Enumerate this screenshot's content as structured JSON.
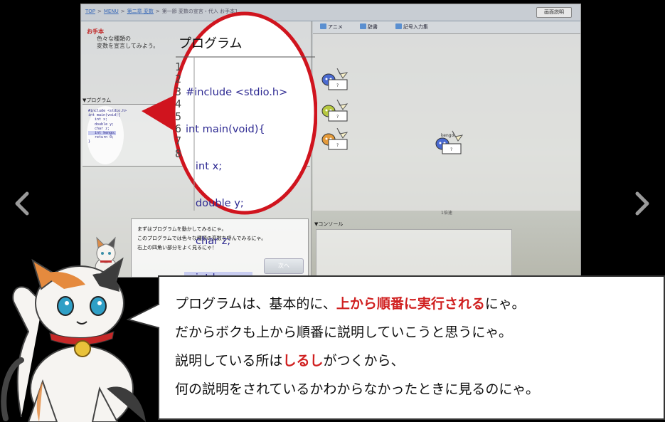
{
  "nav": {
    "prev_icon": "chevron-left-icon",
    "next_icon": "chevron-right-icon"
  },
  "app": {
    "breadcrumb": [
      "TOP",
      "MENU",
      "第二章 変数",
      "第一節 変数の宣言・代入 お手本1"
    ],
    "help_button": "画面説明",
    "otehon_title": "お手本",
    "otehon_body_1": "色々な種類の",
    "otehon_body_2": "変数を宣言してみよう。",
    "program_label": "▼プログラム",
    "tabs": [
      {
        "label": "アニメ",
        "icon": "animation-icon"
      },
      {
        "label": "辞書",
        "icon": "book-icon"
      },
      {
        "label": "記号入力集",
        "icon": "keyboard-icon"
      }
    ],
    "speed_label": "1倍速",
    "console_label": "▼コンソール",
    "variable_name": "kengo",
    "variable_value": "?",
    "dialog_lines": [
      "まずはプログラムを動かしてみるにゃ。",
      "このプログラムでは色々な種類の変数を呼んでみるにゃ。",
      "右上の四角い部分をよく見るにゃ！"
    ],
    "next_button": "次へ"
  },
  "magnifier": {
    "title": "プログラム",
    "line_numbers": [
      "1",
      "2",
      "3",
      "4",
      "5",
      "6",
      "7",
      "8"
    ],
    "code_lines": [
      "#include <stdio.h>",
      "int main(void){",
      "   int x;",
      "   double y;",
      "   char z;",
      "   int kengo;",
      "   return 0;",
      "}"
    ],
    "highlighted_line": 6
  },
  "bubble": {
    "line1_a": "プログラムは、基本的に、",
    "line1_red": "上から順番に実行される",
    "line1_b": "にゃ。",
    "line2": "だからボクも上から順番に説明していこうと思うにゃ。",
    "line3_a": "説明している所は",
    "line3_red": "しるし",
    "line3_b": "がつくから、",
    "line4": "何の説明をされているかわからなかったときに見るのにゃ。"
  },
  "colors": {
    "highlight_red": "#d02020",
    "code_blue": "#2e2a92",
    "magnifier_border": "#d0141e"
  }
}
